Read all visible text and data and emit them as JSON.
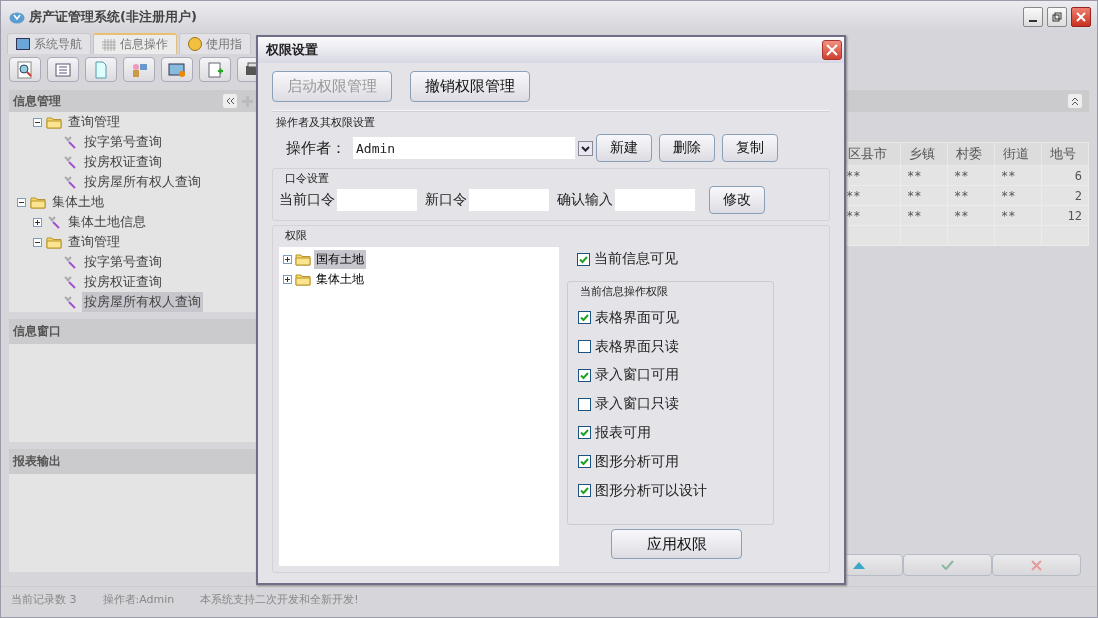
{
  "window": {
    "title": "房产证管理系统(非注册用户)"
  },
  "tabs": [
    {
      "label": "系统导航",
      "selected": false,
      "kind": "monitor"
    },
    {
      "label": "信息操作",
      "selected": true,
      "kind": "grid"
    },
    {
      "label": "使用指",
      "selected": false,
      "kind": "help"
    }
  ],
  "sidebar": {
    "title": "信息管理",
    "tree": {
      "continued": [
        {
          "label": "查询管理",
          "kind": "folder",
          "expanded": true,
          "selected": false,
          "children": [
            {
              "label": "按字第号查询",
              "kind": "tool",
              "selected": false
            },
            {
              "label": "按房权证查询",
              "kind": "tool",
              "selected": false
            },
            {
              "label": "按房屋所有权人查询",
              "kind": "tool",
              "selected": false
            }
          ]
        }
      ],
      "items": [
        {
          "label": "集体土地",
          "kind": "folder",
          "expanded": true,
          "selected": false,
          "children": [
            {
              "label": "集体土地信息",
              "kind": "tool",
              "expanded": false,
              "selected": false
            },
            {
              "label": "查询管理",
              "kind": "folder",
              "expanded": true,
              "selected": false,
              "children": [
                {
                  "label": "按字第号查询",
                  "kind": "tool",
                  "selected": false
                },
                {
                  "label": "按房权证查询",
                  "kind": "tool",
                  "selected": false
                },
                {
                  "label": "按房屋所有权人查询",
                  "kind": "tool",
                  "selected": true
                }
              ]
            }
          ]
        }
      ]
    },
    "panels": [
      {
        "title": "信息窗口"
      },
      {
        "title": "报表输出"
      }
    ]
  },
  "table": {
    "columns": [
      {
        "label": "区县市"
      },
      {
        "label": "乡镇"
      },
      {
        "label": "村委"
      },
      {
        "label": "街道"
      },
      {
        "label": "地号"
      }
    ],
    "rows": [
      [
        "**",
        "**",
        "**",
        "**",
        "6"
      ],
      [
        "**",
        "**",
        "**",
        "**",
        "2"
      ],
      [
        "**",
        "**",
        "**",
        "**",
        "12"
      ]
    ]
  },
  "status_bar": [
    "当前记录数 3",
    "操作者:Admin",
    "本系统支持二次开发和全新开发!"
  ],
  "dialog": {
    "title": "权限设置",
    "top_buttons": [
      {
        "label": "启动权限管理",
        "disabled": true
      },
      {
        "label": "撤销权限管理",
        "disabled": false
      }
    ],
    "operator_group": {
      "title": "操作者及其权限设置",
      "label": "操作者：",
      "value": "Admin",
      "buttons": [
        "新建",
        "删除",
        "复制"
      ]
    },
    "password_group": {
      "title": "口令设置",
      "fields": [
        {
          "label": "当前口令"
        },
        {
          "label": "新口令"
        },
        {
          "label": "确认输入"
        }
      ],
      "button": "修改"
    },
    "permissions": {
      "title": "权限",
      "tree": [
        {
          "label": "国有土地",
          "expanded": false,
          "selected": true
        },
        {
          "label": "集体土地",
          "expanded": false,
          "selected": false
        }
      ],
      "visible_check": {
        "label": "当前信息可见",
        "checked": true
      },
      "ops_title": "当前信息操作权限",
      "options": [
        {
          "label": "表格界面可见",
          "checked": true
        },
        {
          "label": "表格界面只读",
          "checked": false
        },
        {
          "label": "录入窗口可用",
          "checked": true
        },
        {
          "label": "录入窗口只读",
          "checked": false
        },
        {
          "label": "报表可用",
          "checked": true
        },
        {
          "label": "图形分析可用",
          "checked": true
        },
        {
          "label": "图形分析可以设计",
          "checked": true
        }
      ],
      "apply_button": "应用权限"
    }
  }
}
